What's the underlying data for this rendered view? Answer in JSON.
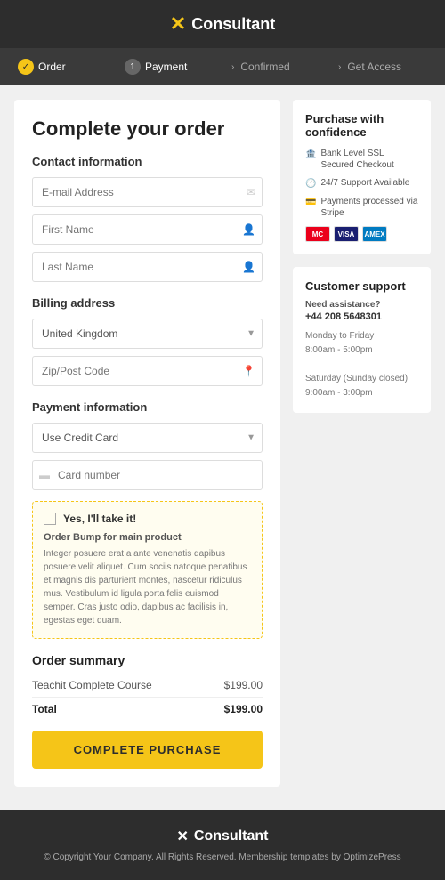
{
  "header": {
    "logo_icon": "✕",
    "logo_text": "Consultant"
  },
  "progress": {
    "steps": [
      {
        "label": "Order",
        "type": "done",
        "icon": "✓"
      },
      {
        "label": "Payment",
        "type": "active",
        "icon": "1"
      },
      {
        "label": "Confirmed",
        "type": "arrow",
        "icon": "›"
      },
      {
        "label": "Get Access",
        "type": "arrow",
        "icon": "›"
      }
    ]
  },
  "form": {
    "title": "Complete your order",
    "contact_section": "Contact information",
    "email_placeholder": "E-mail Address",
    "first_name_placeholder": "First Name",
    "last_name_placeholder": "Last Name",
    "billing_section": "Billing address",
    "country_default": "United Kingdom",
    "zipcode_placeholder": "Zip/Post Code",
    "payment_section": "Payment information",
    "payment_method_default": "Use Credit Card",
    "card_placeholder": "Card number"
  },
  "order_bump": {
    "checkbox_label": "Yes, I'll take it!",
    "product_name": "Order Bump for main product",
    "description": "Integer posuere erat a ante venenatis dapibus posuere velit aliquet. Cum sociis natoque penatibus et magnis dis parturient montes, nascetur ridiculus mus. Vestibulum id ligula porta felis euismod semper. Cras justo odio, dapibus ac facilisis in, egestas eget quam."
  },
  "order_summary": {
    "title": "Order summary",
    "items": [
      {
        "name": "Teachit Complete Course",
        "price": "$199.00"
      }
    ],
    "total_label": "Total",
    "total_price": "$199.00",
    "button_label": "COMPLETE PURCHASE"
  },
  "confidence": {
    "title": "Purchase with confidence",
    "items": [
      {
        "icon": "🏦",
        "text": "Bank Level SSL Secured Checkout"
      },
      {
        "icon": "🕐",
        "text": "24/7 Support Available"
      },
      {
        "icon": "💳",
        "text": "Payments processed via Stripe"
      }
    ],
    "cards": [
      "MC",
      "VISA",
      "AMEX"
    ]
  },
  "support": {
    "title": "Customer support",
    "need_assistance": "Need assistance?",
    "phone": "+44 208 5648301",
    "weekday_hours": "Monday to Friday",
    "weekday_time": "8:00am - 5:00pm",
    "weekend_label": "Saturday (Sunday closed)",
    "weekend_time": "9:00am - 3:00pm"
  },
  "footer": {
    "logo_icon": "✕",
    "logo_text": "Consultant",
    "copyright": "© Copyright Your Company. All Rights Reserved. Membership templates by OptimizePress"
  }
}
